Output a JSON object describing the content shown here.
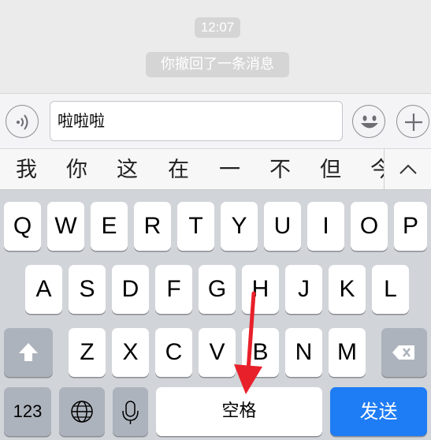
{
  "chat": {
    "time": "12:07",
    "recall_notice": "你撤回了一条消息"
  },
  "input": {
    "value": "啦啦啦",
    "voice_icon": "voice-icon",
    "emoji_icon": "emoji-icon",
    "plus_icon": "plus-icon"
  },
  "candidates": {
    "items": [
      "我",
      "你",
      "这",
      "在",
      "一",
      "不",
      "但",
      "今"
    ],
    "expand_icon": "chevron-up-icon"
  },
  "keyboard": {
    "row1": [
      "Q",
      "W",
      "E",
      "R",
      "T",
      "Y",
      "U",
      "I",
      "O",
      "P"
    ],
    "row2": [
      "A",
      "S",
      "D",
      "F",
      "G",
      "H",
      "J",
      "K",
      "L"
    ],
    "row3": [
      "Z",
      "X",
      "C",
      "V",
      "B",
      "N",
      "M"
    ],
    "shift_icon": "shift-icon",
    "delete_icon": "delete-icon",
    "numbers_label": "123",
    "globe_icon": "globe-icon",
    "mic_icon": "microphone-icon",
    "space_label": "空格",
    "send_label": "发送",
    "colors": {
      "send": "#1e7cf5",
      "annotation_arrow": "#e8202a"
    }
  }
}
